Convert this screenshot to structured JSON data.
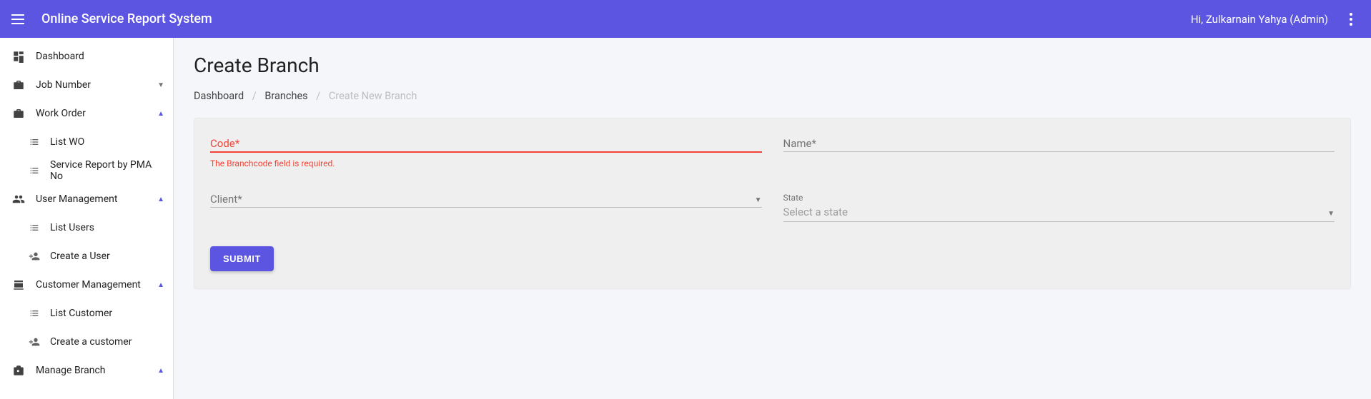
{
  "appbar": {
    "title": "Online Service Report System",
    "user_greeting": "Hi, Zulkarnain Yahya (Admin)"
  },
  "sidebar": {
    "items": [
      {
        "icon": "dashboard",
        "label": "Dashboard",
        "expandable": false
      },
      {
        "icon": "briefcase",
        "label": "Job Number",
        "expandable": true,
        "expanded": false
      },
      {
        "icon": "briefcase",
        "label": "Work Order",
        "expandable": true,
        "expanded": true,
        "children": [
          {
            "icon": "list",
            "label": "List WO"
          },
          {
            "icon": "list",
            "label": "Service Report by PMA No"
          }
        ]
      },
      {
        "icon": "people",
        "label": "User Management",
        "expandable": true,
        "expanded": true,
        "children": [
          {
            "icon": "list",
            "label": "List Users"
          },
          {
            "icon": "person-add",
            "label": "Create a User"
          }
        ]
      },
      {
        "icon": "register",
        "label": "Customer Management",
        "expandable": true,
        "expanded": true,
        "children": [
          {
            "icon": "list",
            "label": "List Customer"
          },
          {
            "icon": "person-add",
            "label": "Create a customer"
          }
        ]
      },
      {
        "icon": "branch",
        "label": "Manage Branch",
        "expandable": true,
        "expanded": true
      }
    ]
  },
  "page": {
    "title": "Create Branch",
    "breadcrumb": {
      "dashboard": "Dashboard",
      "branches": "Branches",
      "current": "Create New Branch"
    }
  },
  "form": {
    "code": {
      "label": "Code*",
      "error": "The Branchcode field is required."
    },
    "name": {
      "label": "Name*"
    },
    "client": {
      "label": "Client*"
    },
    "state": {
      "top_label": "State",
      "placeholder": "Select a state"
    },
    "submit_label": "SUBMIT"
  }
}
